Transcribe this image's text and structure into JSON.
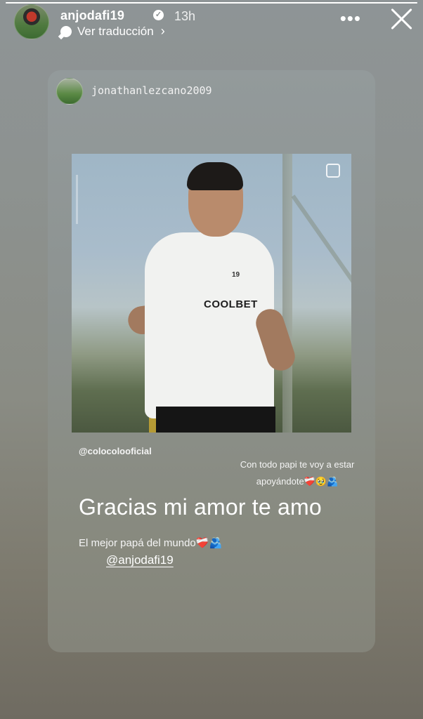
{
  "story": {
    "progress": 1.0,
    "username": "anjodafi19",
    "verified_mark": "✓",
    "time_ago": "13h",
    "translate_label": "Ver traducción",
    "translate_chevron": "›",
    "more_glyph": "•••",
    "icons": [
      "globe-icon",
      "chevron-right-icon",
      "more-icon",
      "close-icon",
      "verified-icon"
    ]
  },
  "shared_post": {
    "username": "jonathanlezcano2009",
    "club_mention": "@colocolooficial",
    "reply_text": "Con todo papi te voy a estar apoyándote❤️‍🩹🥹🫂",
    "big_text": "Gracias mi amor te amo",
    "best_dad_text": "El mejor papá del mundo❤️‍🩹🫂",
    "tag_mention": "@anjodafi19",
    "photo_shirt_text": "COOLBET",
    "photo_shirt_number": "19"
  }
}
